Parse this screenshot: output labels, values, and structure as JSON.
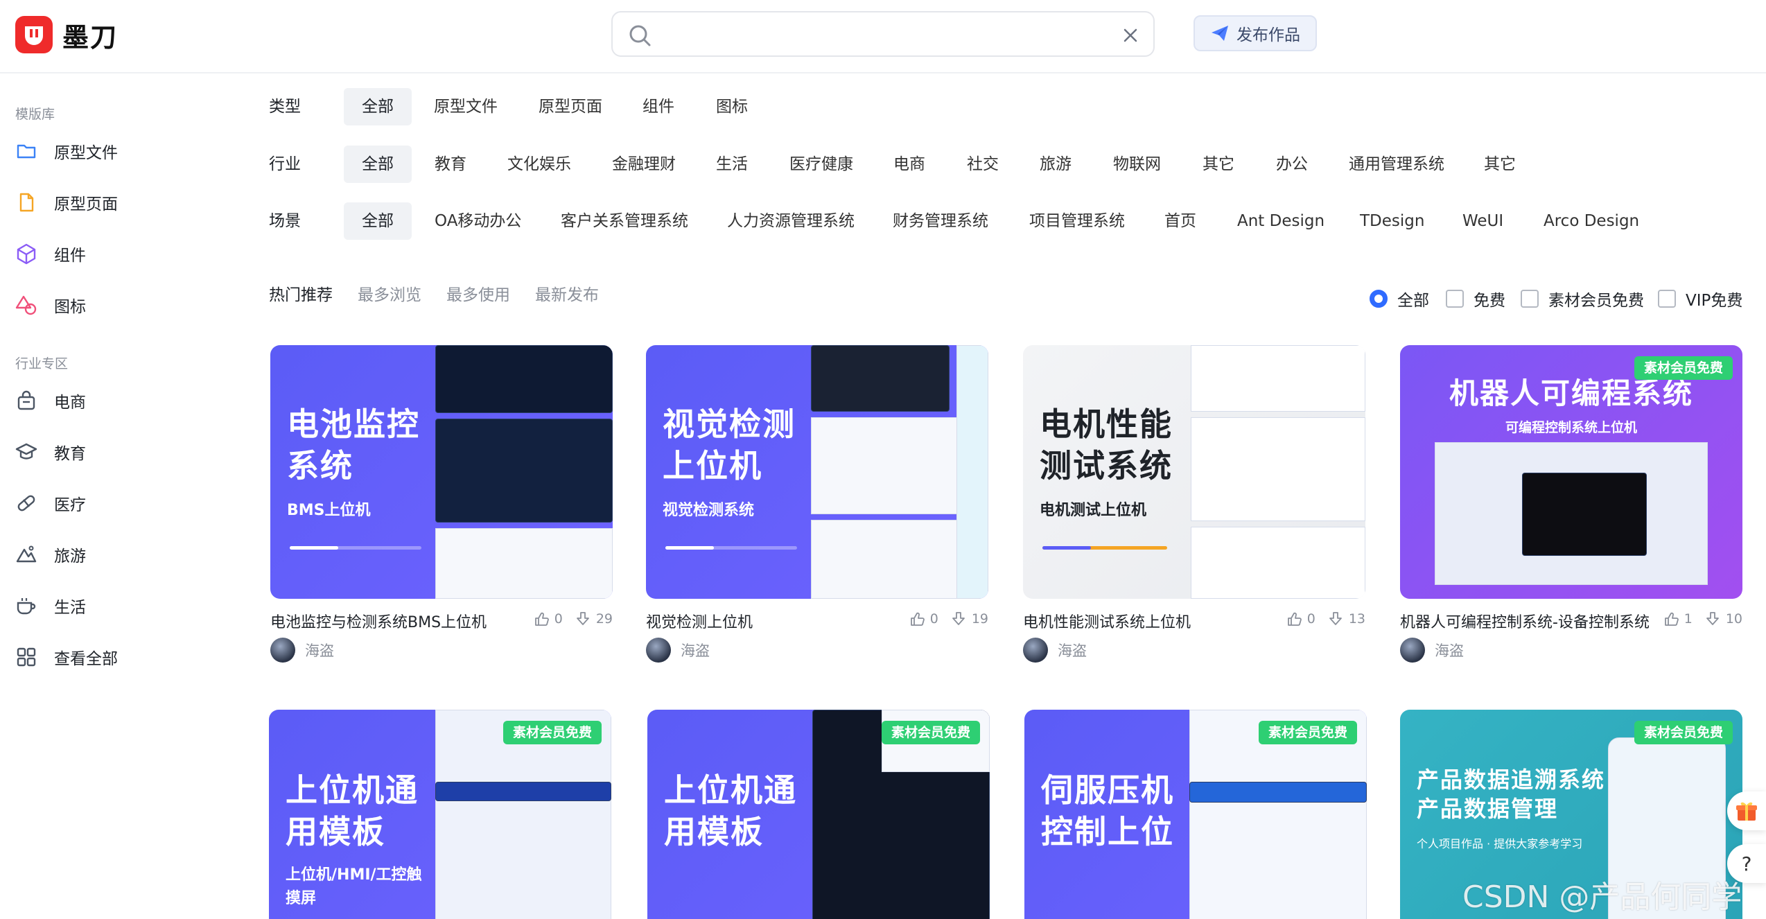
{
  "brand": {
    "name": "墨刀",
    "color": "#ef2b2b"
  },
  "search": {
    "placeholder": ""
  },
  "header": {
    "publish_label": "发布作品"
  },
  "sidebar": {
    "template_heading": "模版库",
    "template_items": [
      "原型文件",
      "原型页面",
      "组件",
      "图标"
    ],
    "industry_heading": "行业专区",
    "industry_items": [
      "电商",
      "教育",
      "医疗",
      "旅游",
      "生活",
      "查看全部"
    ]
  },
  "filters": {
    "type": {
      "label": "类型",
      "options": [
        "全部",
        "原型文件",
        "原型页面",
        "组件",
        "图标"
      ],
      "selected": "全部"
    },
    "industry": {
      "label": "行业",
      "options": [
        "全部",
        "教育",
        "文化娱乐",
        "金融理财",
        "生活",
        "医疗健康",
        "电商",
        "社交",
        "旅游",
        "物联网",
        "其它",
        "办公",
        "通用管理系统",
        "其它"
      ],
      "selected": "全部"
    },
    "scene": {
      "label": "场景",
      "options": [
        "全部",
        "OA移动办公",
        "客户关系管理系统",
        "人力资源管理系统",
        "财务管理系统",
        "项目管理系统",
        "首页",
        "Ant Design",
        "TDesign",
        "WeUI",
        "Arco Design"
      ],
      "selected": "全部"
    }
  },
  "sort_tabs": [
    "热门推荐",
    "最多浏览",
    "最多使用",
    "最新发布"
  ],
  "price_filter": {
    "radio": "全部",
    "checkboxes": [
      "免费",
      "素材会员免费",
      "VIP免费"
    ]
  },
  "cards": [
    {
      "title": "电池监控与检测系统BMS上位机",
      "likes": "0",
      "downloads": "29",
      "author": "海盗",
      "thumb_title": [
        "电池监控",
        "系统"
      ],
      "thumb_sub": "BMS上位机",
      "badge": ""
    },
    {
      "title": "视觉检测上位机",
      "likes": "0",
      "downloads": "19",
      "author": "海盗",
      "thumb_title": [
        "视觉检测",
        "上位机"
      ],
      "thumb_sub": "视觉检测系统",
      "badge": ""
    },
    {
      "title": "电机性能测试系统上位机",
      "likes": "0",
      "downloads": "13",
      "author": "海盗",
      "thumb_title": [
        "电机性能",
        "测试系统"
      ],
      "thumb_sub": "电机测试上位机",
      "badge": ""
    },
    {
      "title": "机器人可编程控制系统-设备控制系统",
      "likes": "1",
      "downloads": "10",
      "author": "海盗",
      "thumb_title": [
        "机器人可编程系统"
      ],
      "thumb_sub": "可编程控制系统上位机",
      "badge": "素材会员免费"
    },
    {
      "title": "",
      "likes": "",
      "downloads": "",
      "author": "",
      "thumb_title": [
        "上位机通",
        "用模板"
      ],
      "thumb_sub": "上位机/HMI/工控触摸屏",
      "badge": "素材会员免费"
    },
    {
      "title": "",
      "likes": "",
      "downloads": "",
      "author": "",
      "thumb_title": [
        "上位机通",
        "用模板"
      ],
      "thumb_sub": "",
      "badge": "素材会员免费"
    },
    {
      "title": "",
      "likes": "",
      "downloads": "",
      "author": "",
      "thumb_title": [
        "伺服压机",
        "控制上位"
      ],
      "thumb_sub": "",
      "badge": "素材会员免费"
    },
    {
      "title": "",
      "likes": "",
      "downloads": "",
      "author": "",
      "thumb_title": [
        "产品数据追溯系统",
        "产品数据管理"
      ],
      "thumb_sub": "个人项目作品 · 提供大家参考学习",
      "badge": "素材会员免费"
    }
  ],
  "watermark": "CSDN @产品何同学",
  "float_buttons": [
    "gift-icon",
    "help-icon"
  ],
  "help_label": "?"
}
